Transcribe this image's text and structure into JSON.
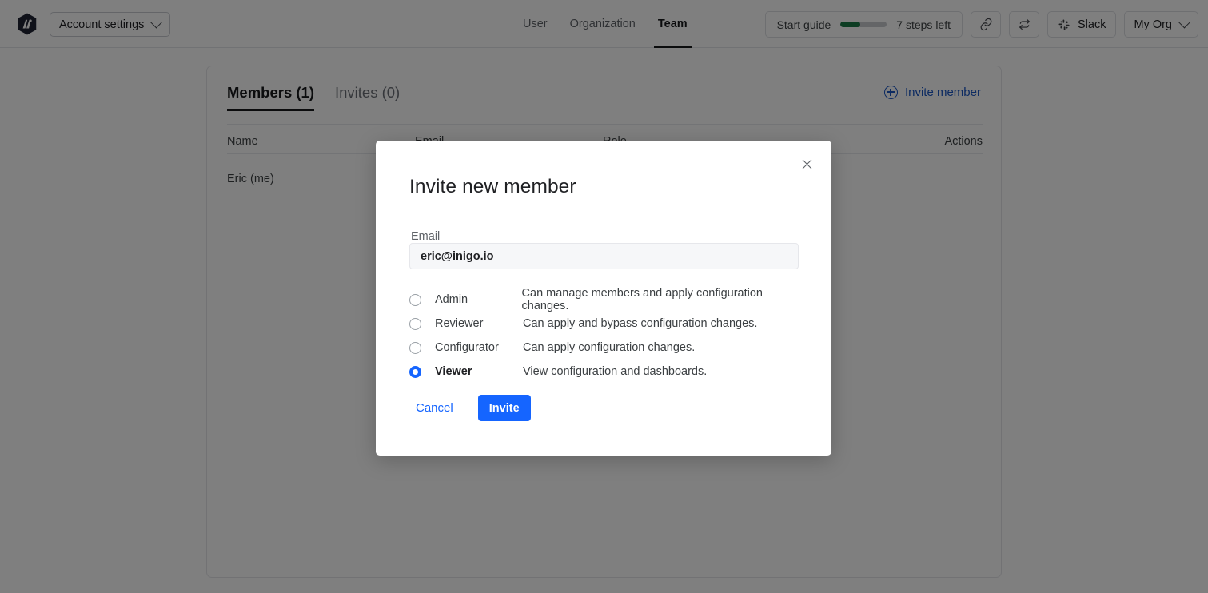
{
  "topbar": {
    "logo_icon": "inigo-logo-icon",
    "account_button": {
      "label": "Account settings",
      "chevron_icon": "chevron-down-icon"
    },
    "nav_tabs": [
      {
        "label": "User",
        "active": false
      },
      {
        "label": "Organization",
        "active": false
      },
      {
        "label": "Team",
        "active": true
      }
    ],
    "start_guide": {
      "label": "Start guide",
      "steps_left": "7 steps left",
      "progress_percent": 42,
      "progress_color": "#1b7a47"
    },
    "link_icon": "link-icon",
    "refresh_icon": "refresh-icon",
    "slack_button": {
      "label": "Slack",
      "icon": "slack-icon"
    },
    "org_button": {
      "label": "My Org",
      "chevron_icon": "chevron-down-icon"
    }
  },
  "card": {
    "tabs": [
      {
        "label": "Members (1)",
        "active": true
      },
      {
        "label": "Invites (0)",
        "active": false
      }
    ],
    "invite_member_link": {
      "label": "Invite member",
      "icon": "plus-circle-icon",
      "color": "#1a56c4"
    },
    "table": {
      "columns": [
        "Name",
        "Email",
        "Role",
        "Actions"
      ],
      "rows": [
        {
          "name": "Eric (me)",
          "email": "",
          "role": "",
          "actions": ""
        }
      ]
    }
  },
  "modal": {
    "title": "Invite new member",
    "close_icon": "close-icon",
    "email_field": {
      "label": "Email",
      "value": "eric@inigo.io",
      "placeholder": "Email"
    },
    "roles": [
      {
        "name": "Admin",
        "description": "Can manage members and apply configuration changes.",
        "selected": false
      },
      {
        "name": "Reviewer",
        "description": "Can apply and bypass configuration changes.",
        "selected": false
      },
      {
        "name": "Configurator",
        "description": "Can apply configuration changes.",
        "selected": false
      },
      {
        "name": "Viewer",
        "description": "View configuration and dashboards.",
        "selected": true
      }
    ],
    "cancel_label": "Cancel",
    "invite_label": "Invite",
    "accent_color": "#1565ff"
  }
}
